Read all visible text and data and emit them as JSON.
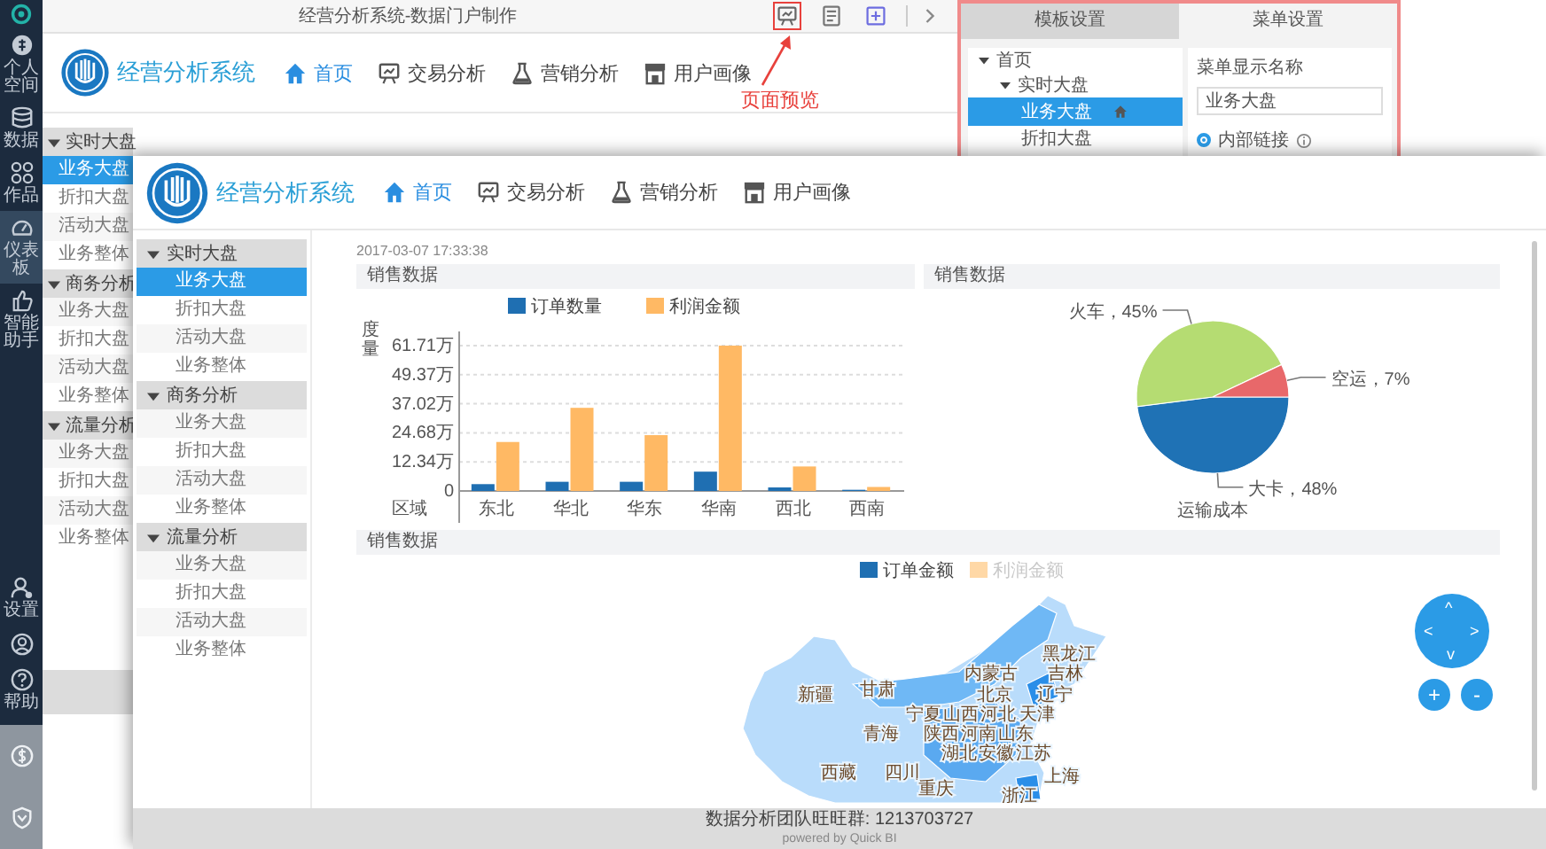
{
  "background_window": {
    "title": "经营分析系统-数据门户制作",
    "rail": {
      "items": [
        {
          "label": "个人空间",
          "selected": false
        },
        {
          "label": "数据",
          "selected": false
        },
        {
          "label": "作品",
          "selected": false
        },
        {
          "label": "仪表板",
          "selected": true
        },
        {
          "label": "智能助手",
          "selected": false
        }
      ],
      "bottom_items": [
        {
          "label": "设置"
        },
        {
          "label": "帮助"
        }
      ]
    },
    "app_name": "经营分析系统",
    "nav": [
      {
        "label": "首页",
        "selected": true
      },
      {
        "label": "交易分析",
        "selected": false
      },
      {
        "label": "营销分析",
        "selected": false
      },
      {
        "label": "用户画像",
        "selected": false
      }
    ],
    "annotation": "页面预览",
    "sidebar": [
      {
        "label": "实时大盘",
        "expanded": true,
        "children": [
          {
            "label": "业务大盘",
            "selected": true
          },
          {
            "label": "折扣大盘",
            "selected": false
          },
          {
            "label": "活动大盘",
            "selected": false
          },
          {
            "label": "业务整体",
            "selected": false
          }
        ]
      },
      {
        "label": "商务分析",
        "expanded": true,
        "children": [
          {
            "label": "业务大盘",
            "selected": false
          },
          {
            "label": "折扣大盘",
            "selected": false
          },
          {
            "label": "活动大盘",
            "selected": false
          },
          {
            "label": "业务整体",
            "selected": false
          }
        ]
      },
      {
        "label": "流量分析",
        "expanded": true,
        "children": [
          {
            "label": "业务大盘",
            "selected": false
          },
          {
            "label": "折扣大盘",
            "selected": false
          },
          {
            "label": "活动大盘",
            "selected": false
          },
          {
            "label": "业务整体",
            "selected": false
          }
        ]
      }
    ],
    "settings_panel": {
      "tabs": [
        {
          "label": "模板设置",
          "selected": false
        },
        {
          "label": "菜单设置",
          "selected": true
        }
      ],
      "tree": [
        {
          "label": "首页",
          "selected": false,
          "children": [
            {
              "label": "实时大盘",
              "selected": false,
              "children": [
                {
                  "label": "业务大盘",
                  "selected": true
                },
                {
                  "label": "折扣大盘",
                  "selected": false
                }
              ]
            }
          ]
        }
      ],
      "field_label": "菜单显示名称",
      "field_value": "业务大盘",
      "radio": {
        "label": "内部链接",
        "checked": true
      }
    }
  },
  "preview_window": {
    "app_name": "经营分析系统",
    "nav": [
      {
        "label": "首页",
        "selected": true
      },
      {
        "label": "交易分析",
        "selected": false
      },
      {
        "label": "营销分析",
        "selected": false
      },
      {
        "label": "用户画像",
        "selected": false
      }
    ],
    "sidebar": [
      {
        "label": "实时大盘",
        "expanded": true,
        "children": [
          {
            "label": "业务大盘",
            "selected": true
          },
          {
            "label": "折扣大盘",
            "selected": false
          },
          {
            "label": "活动大盘",
            "selected": false
          },
          {
            "label": "业务整体",
            "selected": false
          }
        ]
      },
      {
        "label": "商务分析",
        "expanded": true,
        "children": [
          {
            "label": "业务大盘",
            "selected": false
          },
          {
            "label": "折扣大盘",
            "selected": false
          },
          {
            "label": "活动大盘",
            "selected": false
          },
          {
            "label": "业务整体",
            "selected": false
          }
        ]
      },
      {
        "label": "流量分析",
        "expanded": true,
        "children": [
          {
            "label": "业务大盘",
            "selected": false
          },
          {
            "label": "折扣大盘",
            "selected": false
          },
          {
            "label": "活动大盘",
            "selected": false
          },
          {
            "label": "业务整体",
            "selected": false
          }
        ]
      }
    ],
    "timestamp": "2017-03-07 17:33:38",
    "bar_panel": {
      "title": "销售数据",
      "chart_data": {
        "type": "bar",
        "grid": true,
        "legend": true,
        "xlabel": "区域",
        "ylabel": "度量",
        "categories": [
          "东北",
          "华北",
          "华东",
          "华南",
          "西北",
          "西南"
        ],
        "series": [
          {
            "name": "订单数量",
            "color": "#1f6fb2",
            "values": [
              2.9,
              3.9,
              3.9,
              8.2,
              1.5,
              0.5
            ]
          },
          {
            "name": "利润金额",
            "color": "#ffb964",
            "values": [
              20.8,
              35.3,
              23.7,
              61.7,
              10.4,
              1.7
            ]
          }
        ],
        "ylim": [
          0,
          61.71
        ],
        "yticks": [
          {
            "value": 0,
            "label": "0"
          },
          {
            "value": 12.34,
            "label": "12.34万"
          },
          {
            "value": 24.68,
            "label": "24.68万"
          },
          {
            "value": 37.02,
            "label": "37.02万"
          },
          {
            "value": 49.37,
            "label": "49.37万"
          },
          {
            "value": 61.71,
            "label": "61.71万"
          }
        ]
      }
    },
    "pie_panel": {
      "title": "销售数据",
      "chart_data": {
        "type": "pie",
        "title": "运输成本",
        "series": [
          {
            "colors": [
              "#1f72b5",
              "#b5dc72",
              "#e8686a"
            ],
            "values": [
              48,
              45,
              7
            ]
          }
        ],
        "value_labels": [
          "大卡，48%",
          "火车，45%",
          "空运，7%"
        ]
      }
    },
    "map_panel": {
      "title": "销售数据",
      "legend": [
        {
          "name": "订单金额",
          "color": "#1f6fb2",
          "on": true
        },
        {
          "name": "利润金额",
          "color": "#ffd8a6",
          "on": false
        }
      ],
      "regions": [
        "黑龙江",
        "内蒙古",
        "吉林",
        "新疆",
        "甘肃",
        "北京",
        "辽宁",
        "宁夏",
        "山西",
        "河北",
        "天津",
        "青海",
        "陕西",
        "河南",
        "山东",
        "湖北",
        "安徽",
        "江苏",
        "西藏",
        "四川",
        "重庆",
        "上海",
        "浙江"
      ],
      "pan_controls": [
        "^",
        "<",
        ">",
        "v"
      ],
      "zoom_controls": [
        "+",
        "-"
      ]
    },
    "footer": {
      "contact": "数据分析团队旺旺群: 1213703727",
      "credit": "powered by Quick BI"
    }
  }
}
